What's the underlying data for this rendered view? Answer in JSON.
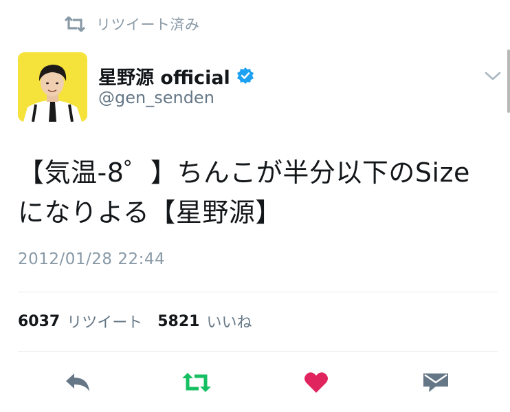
{
  "retweeted_banner": {
    "label": "リツイート済み",
    "icon": "retweet-icon"
  },
  "author": {
    "display_name": "星野源 official",
    "handle": "@gen_senden",
    "verified": true,
    "avatar_bg": "#f5e33b"
  },
  "tweet": {
    "text_lines": [
      "【気温-8゜】ちんこが半分以下のSize",
      "になりよる【星野源】"
    ],
    "timestamp": "2012/01/28 22:44"
  },
  "stats": {
    "retweet_count": "6037",
    "retweet_label": "リツイート",
    "like_count": "5821",
    "like_label": "いいね"
  },
  "actions": [
    {
      "name": "reply",
      "icon": "reply-icon"
    },
    {
      "name": "retweet",
      "icon": "retweet-icon"
    },
    {
      "name": "like",
      "icon": "heart-icon"
    },
    {
      "name": "message",
      "icon": "envelope-icon"
    }
  ],
  "colors": {
    "secondary_text": "#8899a6",
    "handle_text": "#657786",
    "retweet_active": "#17bf63",
    "like_active": "#e0245e",
    "verified_blue": "#1da1f2",
    "action_grey": "#657786"
  }
}
